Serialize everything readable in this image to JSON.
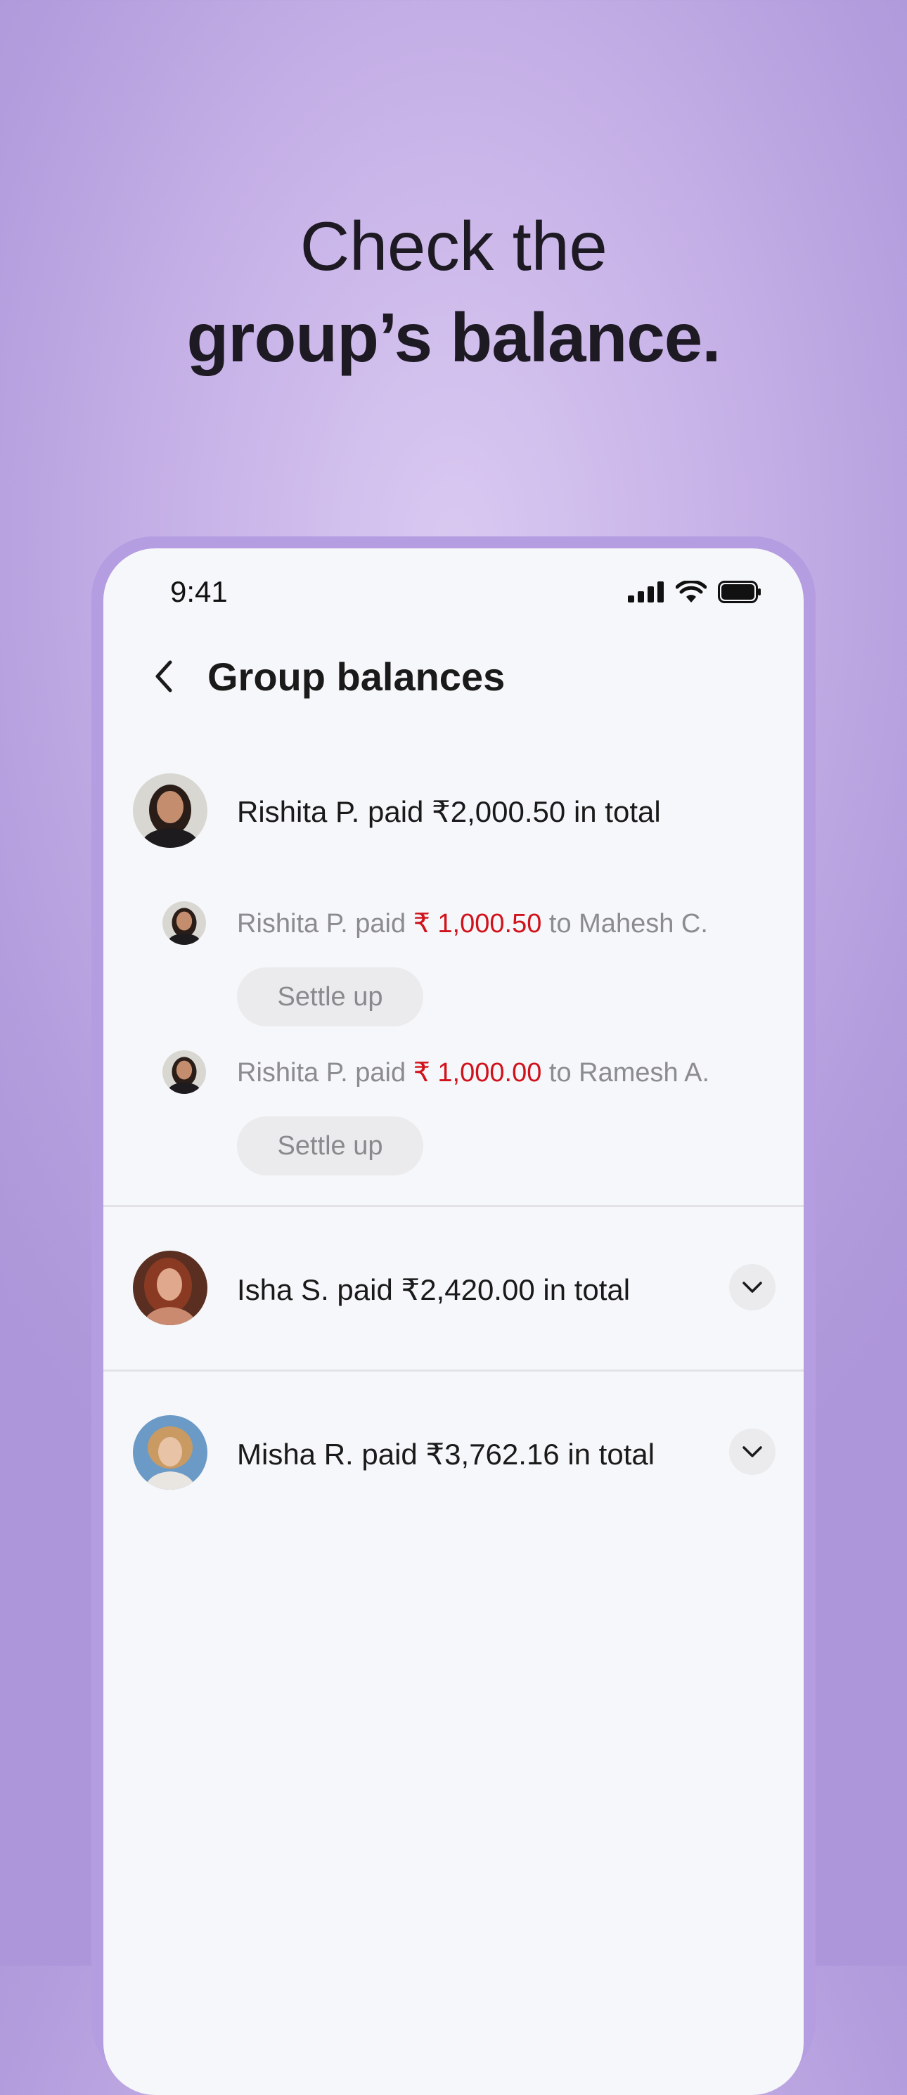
{
  "headline": {
    "line1": "Check the",
    "line2": "group’s balance."
  },
  "status_bar": {
    "time": "9:41"
  },
  "nav": {
    "title": "Group balances"
  },
  "balances": [
    {
      "summary": "Rishita P. paid ₹2,000.50 in total",
      "expanded": true,
      "details": [
        {
          "prefix": "Rishita P. paid ",
          "amount": "₹ 1,000.50",
          "suffix": " to Mahesh C.",
          "action": "Settle up"
        },
        {
          "prefix": "Rishita P. paid ",
          "amount": "₹ 1,000.00",
          "suffix": " to Ramesh A.",
          "action": "Settle up"
        }
      ]
    },
    {
      "summary": "Isha S. paid ₹2,420.00 in total",
      "expanded": false
    },
    {
      "summary": "Misha R. paid ₹3,762.16 in total",
      "expanded": false
    }
  ],
  "colors": {
    "accent_negative": "#d0121b",
    "background": "#b49de0"
  }
}
